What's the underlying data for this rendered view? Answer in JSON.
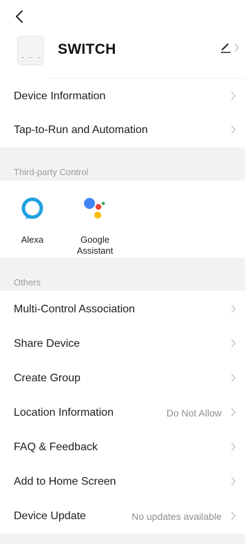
{
  "device": {
    "name": "SWITCH"
  },
  "menu_top": [
    {
      "label": "Device Information"
    },
    {
      "label": "Tap-to-Run and Automation"
    }
  ],
  "third_party": {
    "heading": "Third-party Control",
    "items": [
      {
        "label": "Alexa",
        "icon": "alexa-icon"
      },
      {
        "label": "Google Assistant",
        "icon": "google-assistant-icon"
      }
    ]
  },
  "others": {
    "heading": "Others",
    "items": [
      {
        "label": "Multi-Control Association",
        "value": ""
      },
      {
        "label": "Share Device",
        "value": ""
      },
      {
        "label": "Create Group",
        "value": ""
      },
      {
        "label": "Location Information",
        "value": "Do Not Allow"
      },
      {
        "label": "FAQ & Feedback",
        "value": ""
      },
      {
        "label": "Add to Home Screen",
        "value": ""
      },
      {
        "label": "Device Update",
        "value": "No updates available"
      }
    ]
  },
  "colors": {
    "alexa_blue": "#1FA1E1",
    "google_blue": "#4285F4",
    "google_red": "#EA4335",
    "google_yellow": "#FBBC05",
    "google_green": "#34A853",
    "section_band": "#F2F2F2"
  }
}
